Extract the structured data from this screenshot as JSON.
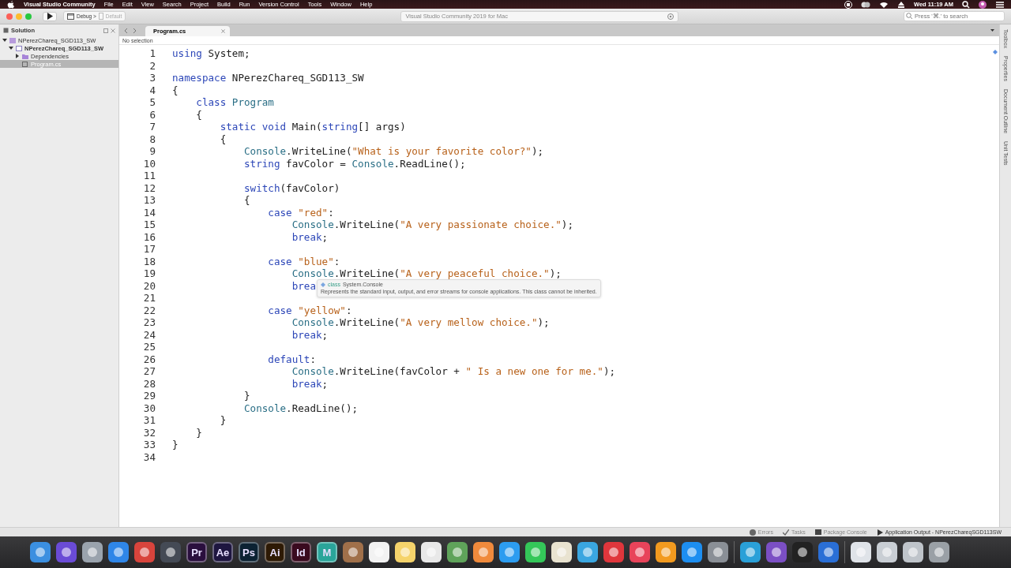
{
  "menu_bar": {
    "app_name": "Visual Studio Community",
    "items": [
      "File",
      "Edit",
      "View",
      "Search",
      "Project",
      "Build",
      "Run",
      "Version Control",
      "Tools",
      "Window",
      "Help"
    ],
    "clock": "Wed 11:19 AM"
  },
  "toolbar": {
    "configuration": "Debug >",
    "target": "Default",
    "status": "Visual Studio Community 2019 for Mac",
    "search": {
      "placeholder": "Press '⌘.' to search"
    }
  },
  "solution_pad": {
    "title": "Solution",
    "tree": [
      {
        "label": "NPerezChareq_SGD113_SW",
        "kind": "solution",
        "expanded": true,
        "selected": false,
        "children": [
          {
            "label": "NPerezChareq_SGD113_SW",
            "kind": "project",
            "expanded": true,
            "selected": false,
            "children": [
              {
                "label": "Dependencies",
                "kind": "folder",
                "expanded": false,
                "selected": false
              },
              {
                "label": "Program.cs",
                "kind": "file",
                "selected": true
              }
            ]
          }
        ]
      }
    ]
  },
  "tabs": [
    {
      "label": "Program.cs",
      "selected": true
    }
  ],
  "breadcrumb": "No selection",
  "editor": {
    "lines": [
      {
        "number": "1",
        "tokens": [
          {
            "kind": "kw",
            "text": "using"
          },
          {
            "kind": "plain",
            "text": " System;"
          }
        ]
      },
      {
        "number": "2"
      },
      {
        "number": "3",
        "tokens": [
          {
            "kind": "kw",
            "text": "namespace"
          },
          {
            "kind": "plain",
            "text": " NPerezChareq_SGD113_SW"
          }
        ]
      },
      {
        "number": "4",
        "tokens": [
          {
            "kind": "plain",
            "text": "{"
          }
        ]
      },
      {
        "number": "5",
        "tokens": [
          {
            "kind": "kw",
            "text": "    class"
          },
          {
            "kind": "type",
            "text": " Program"
          }
        ]
      },
      {
        "number": "6",
        "tokens": [
          {
            "kind": "plain",
            "text": "    {"
          }
        ]
      },
      {
        "number": "7",
        "tokens": [
          {
            "kind": "kw",
            "text": "        static void"
          },
          {
            "kind": "plain",
            "text": " Main("
          },
          {
            "kind": "kw",
            "text": "string"
          },
          {
            "kind": "plain",
            "text": "[] args)"
          }
        ]
      },
      {
        "number": "8",
        "tokens": [
          {
            "kind": "plain",
            "text": "        {"
          }
        ]
      },
      {
        "number": "9",
        "tokens": [
          {
            "kind": "type",
            "text": "            Console"
          },
          {
            "kind": "plain",
            "text": ".WriteLine("
          },
          {
            "kind": "str",
            "text": "\"What is your favorite color?\""
          },
          {
            "kind": "plain",
            "text": ");"
          }
        ]
      },
      {
        "number": "10",
        "tokens": [
          {
            "kind": "kw",
            "text": "            string"
          },
          {
            "kind": "plain",
            "text": " favColor = "
          },
          {
            "kind": "type",
            "text": "Console"
          },
          {
            "kind": "plain",
            "text": ".ReadLine();"
          }
        ]
      },
      {
        "number": "11"
      },
      {
        "number": "12",
        "tokens": [
          {
            "kind": "kw",
            "text": "            switch"
          },
          {
            "kind": "plain",
            "text": "(favColor)"
          }
        ]
      },
      {
        "number": "13",
        "tokens": [
          {
            "kind": "plain",
            "text": "            {"
          }
        ]
      },
      {
        "number": "14",
        "tokens": [
          {
            "kind": "kw",
            "text": "                case"
          },
          {
            "kind": "str",
            "text": " \"red\""
          },
          {
            "kind": "plain",
            "text": ":"
          }
        ]
      },
      {
        "number": "15",
        "tokens": [
          {
            "kind": "type",
            "text": "                    Console"
          },
          {
            "kind": "plain",
            "text": ".WriteLine("
          },
          {
            "kind": "str",
            "text": "\"A very passionate choice.\""
          },
          {
            "kind": "plain",
            "text": ");"
          }
        ]
      },
      {
        "number": "16",
        "tokens": [
          {
            "kind": "kw",
            "text": "                    break"
          },
          {
            "kind": "plain",
            "text": ";"
          }
        ]
      },
      {
        "number": "17"
      },
      {
        "number": "18",
        "tokens": [
          {
            "kind": "kw",
            "text": "                case"
          },
          {
            "kind": "str",
            "text": " \"blue\""
          },
          {
            "kind": "plain",
            "text": ":"
          }
        ]
      },
      {
        "number": "19",
        "tokens": [
          {
            "kind": "type",
            "text": "                    Console"
          },
          {
            "kind": "plain",
            "text": ".WriteLine("
          },
          {
            "kind": "str",
            "text": "\"A very peaceful choice.\""
          },
          {
            "kind": "plain",
            "text": ");"
          }
        ]
      },
      {
        "number": "20",
        "tokens": [
          {
            "kind": "kw",
            "text": "                    brea"
          }
        ]
      },
      {
        "number": "21"
      },
      {
        "number": "22",
        "tokens": [
          {
            "kind": "kw",
            "text": "                case"
          },
          {
            "kind": "str",
            "text": " \"yellow\""
          },
          {
            "kind": "plain",
            "text": ":"
          }
        ]
      },
      {
        "number": "23",
        "tokens": [
          {
            "kind": "type",
            "text": "                    Console"
          },
          {
            "kind": "plain",
            "text": ".WriteLine("
          },
          {
            "kind": "str",
            "text": "\"A very mellow choice.\""
          },
          {
            "kind": "plain",
            "text": ");"
          }
        ]
      },
      {
        "number": "24",
        "tokens": [
          {
            "kind": "kw",
            "text": "                    break"
          },
          {
            "kind": "plain",
            "text": ";"
          }
        ]
      },
      {
        "number": "25"
      },
      {
        "number": "26",
        "tokens": [
          {
            "kind": "kw",
            "text": "                default"
          },
          {
            "kind": "plain",
            "text": ":"
          }
        ]
      },
      {
        "number": "27",
        "tokens": [
          {
            "kind": "type",
            "text": "                    Console"
          },
          {
            "kind": "plain",
            "text": ".WriteLine(favColor + "
          },
          {
            "kind": "str",
            "text": "\" Is a new one for me.\""
          },
          {
            "kind": "plain",
            "text": ");"
          }
        ]
      },
      {
        "number": "28",
        "tokens": [
          {
            "kind": "kw",
            "text": "                    break"
          },
          {
            "kind": "plain",
            "text": ";"
          }
        ]
      },
      {
        "number": "29",
        "tokens": [
          {
            "kind": "plain",
            "text": "            }"
          }
        ]
      },
      {
        "number": "30",
        "tokens": [
          {
            "kind": "type",
            "text": "            Console"
          },
          {
            "kind": "plain",
            "text": ".ReadLine();"
          }
        ]
      },
      {
        "number": "31",
        "tokens": [
          {
            "kind": "plain",
            "text": "        }"
          }
        ]
      },
      {
        "number": "32",
        "tokens": [
          {
            "kind": "plain",
            "text": "    }"
          }
        ]
      },
      {
        "number": "33",
        "tokens": [
          {
            "kind": "plain",
            "text": "}"
          }
        ]
      },
      {
        "number": "34"
      }
    ],
    "tooltip": {
      "signature_keyword": "class",
      "signature": "System.Console",
      "description": "Represents the standard input, output, and error streams for console applications. This class cannot be inherited."
    }
  },
  "right_pads": [
    "Toolbox",
    "Properties",
    "Document Outline",
    "Unit Tests"
  ],
  "status_bar": [
    {
      "label": "Errors",
      "kind": "errors"
    },
    {
      "label": "Tasks",
      "kind": "tasks"
    },
    {
      "label": "Package Console",
      "kind": "console"
    },
    {
      "label": "Application Output - NPerezChareqSGD113SW",
      "kind": "output"
    }
  ],
  "dock": [
    {
      "kind": "shape",
      "color": "#3b8fe0"
    },
    {
      "kind": "shape",
      "color": "#6a4bd6"
    },
    {
      "kind": "shape",
      "color": "#9aa3ad"
    },
    {
      "kind": "shape",
      "color": "#2f86e8"
    },
    {
      "kind": "shape",
      "color": "#d8443c"
    },
    {
      "kind": "shape",
      "color": "#444a55"
    },
    {
      "kind": "letter",
      "label": "Pr",
      "color": "#2a0f3e"
    },
    {
      "kind": "letter",
      "label": "Ae",
      "color": "#1e1640"
    },
    {
      "kind": "letter",
      "label": "Ps",
      "color": "#0c2233"
    },
    {
      "kind": "letter",
      "label": "Ai",
      "color": "#2e1a05"
    },
    {
      "kind": "letter",
      "label": "Id",
      "color": "#3a0a1f"
    },
    {
      "kind": "letter",
      "label": "M",
      "color": "#2aa59a"
    },
    {
      "kind": "shape",
      "color": "#a0704a"
    },
    {
      "kind": "shape",
      "color": "#f2f2f2"
    },
    {
      "kind": "shape",
      "color": "#f5d36b"
    },
    {
      "kind": "shape",
      "color": "#e8e8e8"
    },
    {
      "kind": "shape",
      "color": "#5fa35a"
    },
    {
      "kind": "shape",
      "color": "#f08a3c"
    },
    {
      "kind": "shape",
      "color": "#2c9cf0"
    },
    {
      "kind": "shape",
      "color": "#34c759"
    },
    {
      "kind": "shape",
      "color": "#e9e3d0"
    },
    {
      "kind": "shape",
      "color": "#3aa6e0"
    },
    {
      "kind": "shape",
      "color": "#e0363c"
    },
    {
      "kind": "shape",
      "color": "#e8435a"
    },
    {
      "kind": "shape",
      "color": "#f29a1f"
    },
    {
      "kind": "shape",
      "color": "#1d8ef0"
    },
    {
      "kind": "shape",
      "color": "#8a8f96"
    },
    {
      "kind": "separator"
    },
    {
      "kind": "shape",
      "color": "#2aa0d8"
    },
    {
      "kind": "shape",
      "color": "#7b4fc4"
    },
    {
      "kind": "shape",
      "color": "#222222"
    },
    {
      "kind": "shape",
      "color": "#2a6fd6"
    },
    {
      "kind": "separator"
    },
    {
      "kind": "shape",
      "color": "#dfe3e8"
    },
    {
      "kind": "shape",
      "color": "#c9ced4"
    },
    {
      "kind": "shape",
      "color": "#bfc4ca"
    },
    {
      "kind": "shape",
      "color": "#9aa0a6"
    }
  ]
}
